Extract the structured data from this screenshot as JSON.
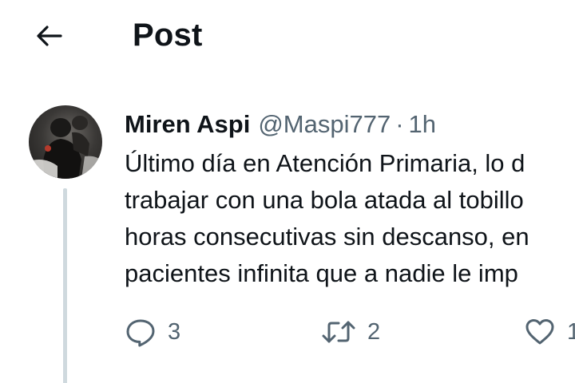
{
  "header": {
    "back_icon": "arrow-left-icon",
    "title": "Post"
  },
  "post": {
    "avatar_icon": "user-avatar",
    "author_name": "Miren Aspi",
    "author_handle": "@Maspi777",
    "separator": "·",
    "time": "1h",
    "text_lines": [
      "Último día en Atención Primaria, lo d",
      "trabajar con una bola atada al tobillo",
      "horas consecutivas sin descanso, en",
      "pacientes infinita que a nadie le imp"
    ],
    "actions": {
      "reply_icon": "reply-icon",
      "reply_count": "3",
      "repost_icon": "repost-icon",
      "repost_count": "2",
      "like_icon": "heart-icon",
      "like_count": "1"
    }
  },
  "colors": {
    "text": "#0f1419",
    "secondary": "#536471",
    "thread_line": "#cfd9de",
    "background": "#ffffff"
  }
}
